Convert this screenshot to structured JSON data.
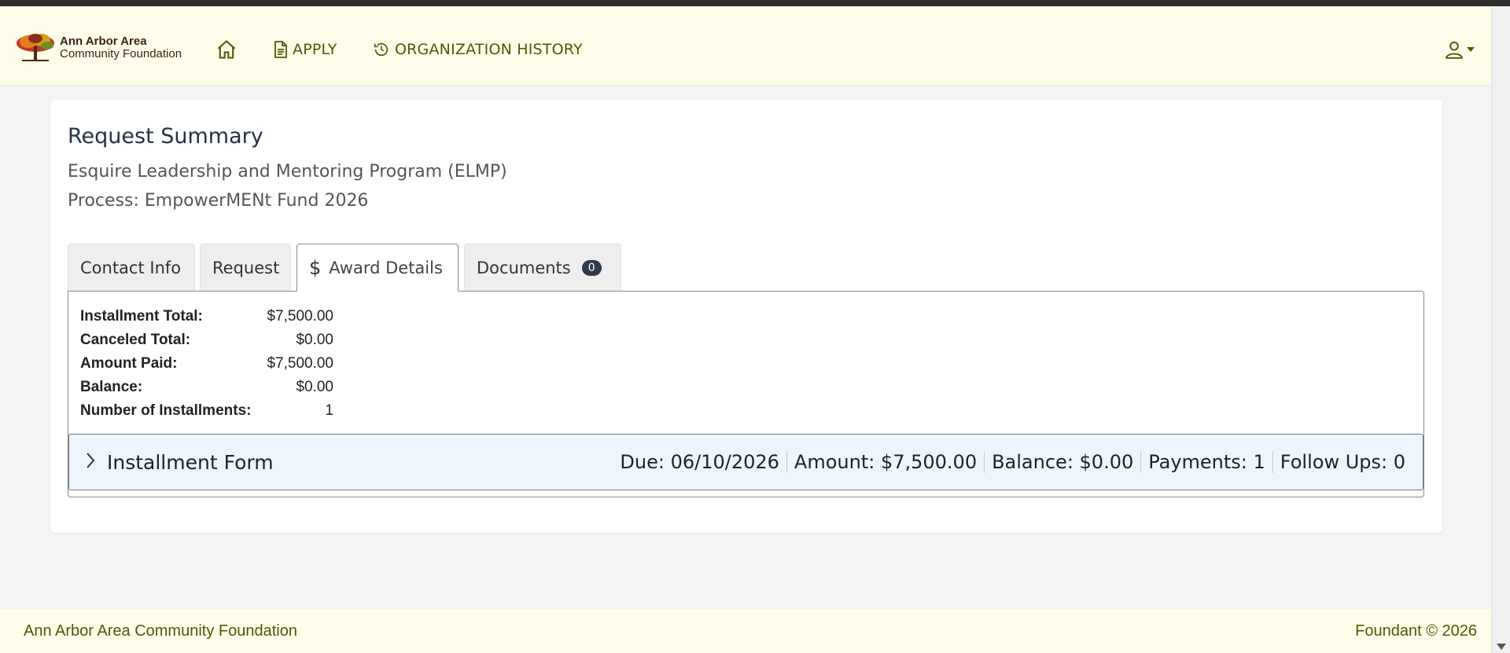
{
  "header": {
    "logo_line1": "Ann Arbor Area",
    "logo_line2": "Community Foundation",
    "nav": {
      "apply": "APPLY",
      "history": "ORGANIZATION HISTORY"
    }
  },
  "summary": {
    "title": "Request Summary",
    "organization": "Esquire Leadership and Mentoring Program (ELMP)",
    "process": "Process: EmpowerMENt Fund 2026"
  },
  "tabs": {
    "contact": "Contact Info",
    "request": "Request",
    "award": "Award Details",
    "documents": "Documents",
    "documents_count": "0"
  },
  "award": {
    "rows": [
      {
        "label": "Installment Total:",
        "value": "$7,500.00"
      },
      {
        "label": "Canceled Total:",
        "value": "$0.00"
      },
      {
        "label": "Amount Paid:",
        "value": "$7,500.00"
      },
      {
        "label": "Balance:",
        "value": "$0.00"
      },
      {
        "label": "Number of Installments:",
        "value": "1"
      }
    ],
    "installment": {
      "title": "Installment Form",
      "due": "Due: 06/10/2026",
      "amount": "Amount: $7,500.00",
      "balance": "Balance: $0.00",
      "payments": "Payments: 1",
      "follow_ups": "Follow Ups: 0"
    }
  },
  "footer": {
    "left": "Ann Arbor Area Community Foundation",
    "right": "Foundant © 2026"
  },
  "colors": {
    "nav_bg": "#fefde9",
    "nav_text": "#4b5a06",
    "installment_bg": "#eef6fd",
    "badge_bg": "#2e3a49"
  }
}
